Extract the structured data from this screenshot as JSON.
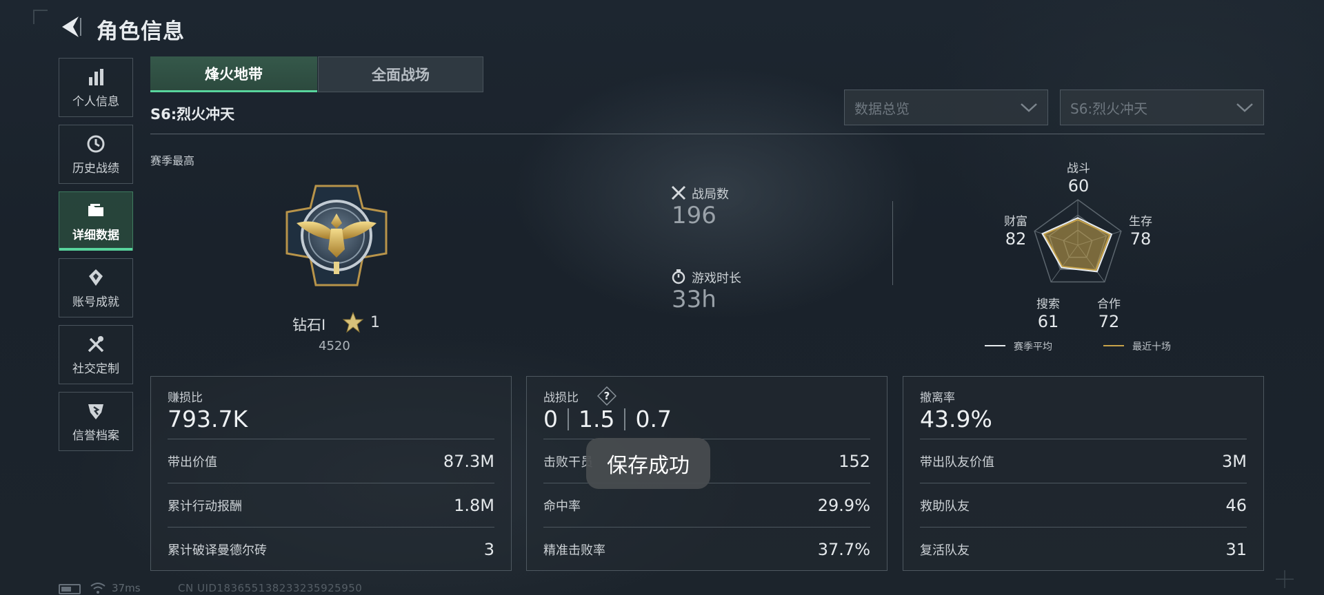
{
  "header": {
    "title": "角色信息"
  },
  "sidebar": {
    "items": [
      {
        "label": "个人信息",
        "icon": "bar-chart-icon"
      },
      {
        "label": "历史战绩",
        "icon": "history-icon"
      },
      {
        "label": "详细数据",
        "icon": "folder-icon",
        "active": true
      },
      {
        "label": "账号成就",
        "icon": "achievement-icon"
      },
      {
        "label": "社交定制",
        "icon": "tools-icon"
      },
      {
        "label": "信誉档案",
        "icon": "shield-icon"
      }
    ]
  },
  "tabs": [
    {
      "label": "烽火地带",
      "active": true
    },
    {
      "label": "全面战场",
      "active": false
    }
  ],
  "season": {
    "title": "S6:烈火冲天"
  },
  "filters": {
    "view": "数据总览",
    "season": "S6:烈火冲天"
  },
  "rank": {
    "section_label": "赛季最高",
    "name": "钻石Ⅰ",
    "stars": "1",
    "score": "4520"
  },
  "match_stats": {
    "matches": {
      "label": "战局数",
      "value": "196"
    },
    "playtime": {
      "label": "游戏时长",
      "value": "33h"
    }
  },
  "radar": {
    "labels": {
      "combat": {
        "label": "战斗",
        "value": "60"
      },
      "survival": {
        "label": "生存",
        "value": "78"
      },
      "teamwork": {
        "label": "合作",
        "value": "72"
      },
      "search": {
        "label": "搜索",
        "value": "61"
      },
      "wealth": {
        "label": "财富",
        "value": "82"
      }
    },
    "order": [
      "combat",
      "survival",
      "teamwork",
      "search",
      "wealth"
    ],
    "season_avg": [
      60,
      78,
      72,
      61,
      82
    ],
    "recent_ten": [
      56,
      74,
      68,
      58,
      78
    ],
    "legend": {
      "season_avg": "赛季平均",
      "recent_ten": "最近十场"
    },
    "colors": {
      "season_avg": "#e8ecef",
      "recent_ten": "#c9a44a"
    }
  },
  "cards": {
    "profit": {
      "label": "赚损比",
      "value": "793.7K",
      "rows": [
        {
          "k": "带出价值",
          "v": "87.3M"
        },
        {
          "k": "累计行动报酬",
          "v": "1.8M"
        },
        {
          "k": "累计破译曼德尔砖",
          "v": "3"
        }
      ]
    },
    "combat": {
      "label": "战损比",
      "values": [
        "0",
        "1.5",
        "0.7"
      ],
      "rows": [
        {
          "k": "击败干员",
          "v": "152"
        },
        {
          "k": "命中率",
          "v": "29.9%"
        },
        {
          "k": "精准击败率",
          "v": "37.7%"
        }
      ]
    },
    "extract": {
      "label": "撤离率",
      "value": "43.9%",
      "rows": [
        {
          "k": "带出队友价值",
          "v": "3M"
        },
        {
          "k": "救助队友",
          "v": "46"
        },
        {
          "k": "复活队友",
          "v": "31"
        }
      ]
    }
  },
  "toast": {
    "text": "保存成功"
  },
  "footer": {
    "ping": "37ms",
    "uid": "CN UID183655138233235925950"
  },
  "colors": {
    "accent": "#58d49c",
    "gold": "#c9a44a"
  }
}
